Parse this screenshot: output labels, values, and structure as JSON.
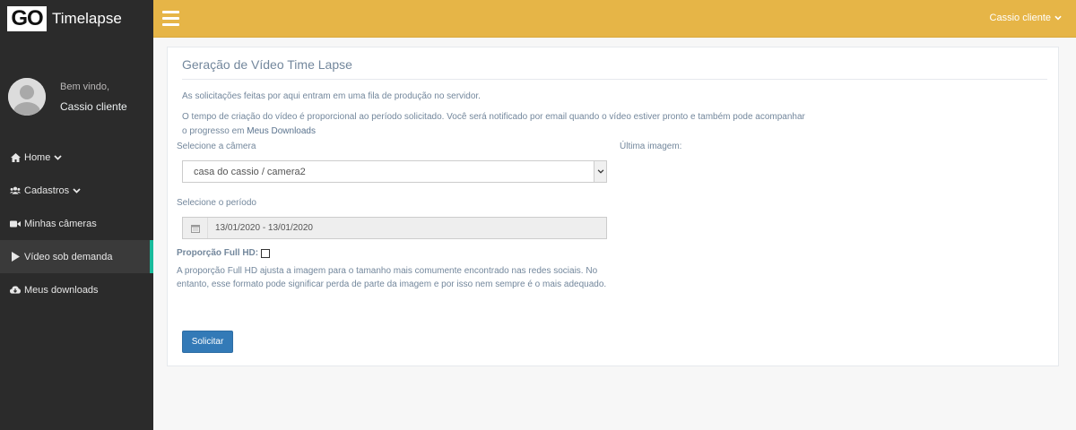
{
  "brand": {
    "logo_text": "GO",
    "name": "Timelapse"
  },
  "profile": {
    "welcome": "Bem vindo,",
    "name": "Cassio cliente"
  },
  "sidebar": {
    "items": [
      {
        "label": "Home",
        "icon": "home-icon",
        "has_chevron": true
      },
      {
        "label": "Cadastros",
        "icon": "users-icon",
        "has_chevron": true
      },
      {
        "label": "Minhas câmeras",
        "icon": "video-camera-icon",
        "has_chevron": false
      },
      {
        "label": "Vídeo sob demanda",
        "icon": "play-icon",
        "has_chevron": false,
        "active": true
      },
      {
        "label": "Meus downloads",
        "icon": "cloud-download-icon",
        "has_chevron": false
      }
    ]
  },
  "topbar": {
    "user_menu": "Cassio cliente"
  },
  "panel": {
    "title": "Geração de Vídeo Time Lapse",
    "para1": "As solicitações feitas por aqui entram em uma fila de produção no servidor.",
    "para2_text": "O tempo de criação do vídeo é proporcional ao período solicitado. Você será notificado por email quando o vídeo estiver pronto e também pode acompanhar o progresso em ",
    "para2_link": "Meus Downloads",
    "camera_label": "Selecione a câmera",
    "camera_value": "casa do cassio / camera2",
    "last_image_label": "Última imagem:",
    "period_label": "Selecione o período",
    "period_value": "13/01/2020 - 13/01/2020",
    "fullhd_label": "Proporção Full HD:",
    "fullhd_checked": false,
    "fullhd_desc": "A proporção Full HD ajusta a imagem para o tamanho mais comumente encontrado nas redes sociais. No entanto, esse formato pode significar perda de parte da imagem e por isso nem sempre é o mais adequado.",
    "submit_label": "Solicitar"
  },
  "colors": {
    "topbar": "#e6b547",
    "sidebar": "#2b2b2b",
    "active_accent": "#1abb9c",
    "button": "#337ab7"
  }
}
